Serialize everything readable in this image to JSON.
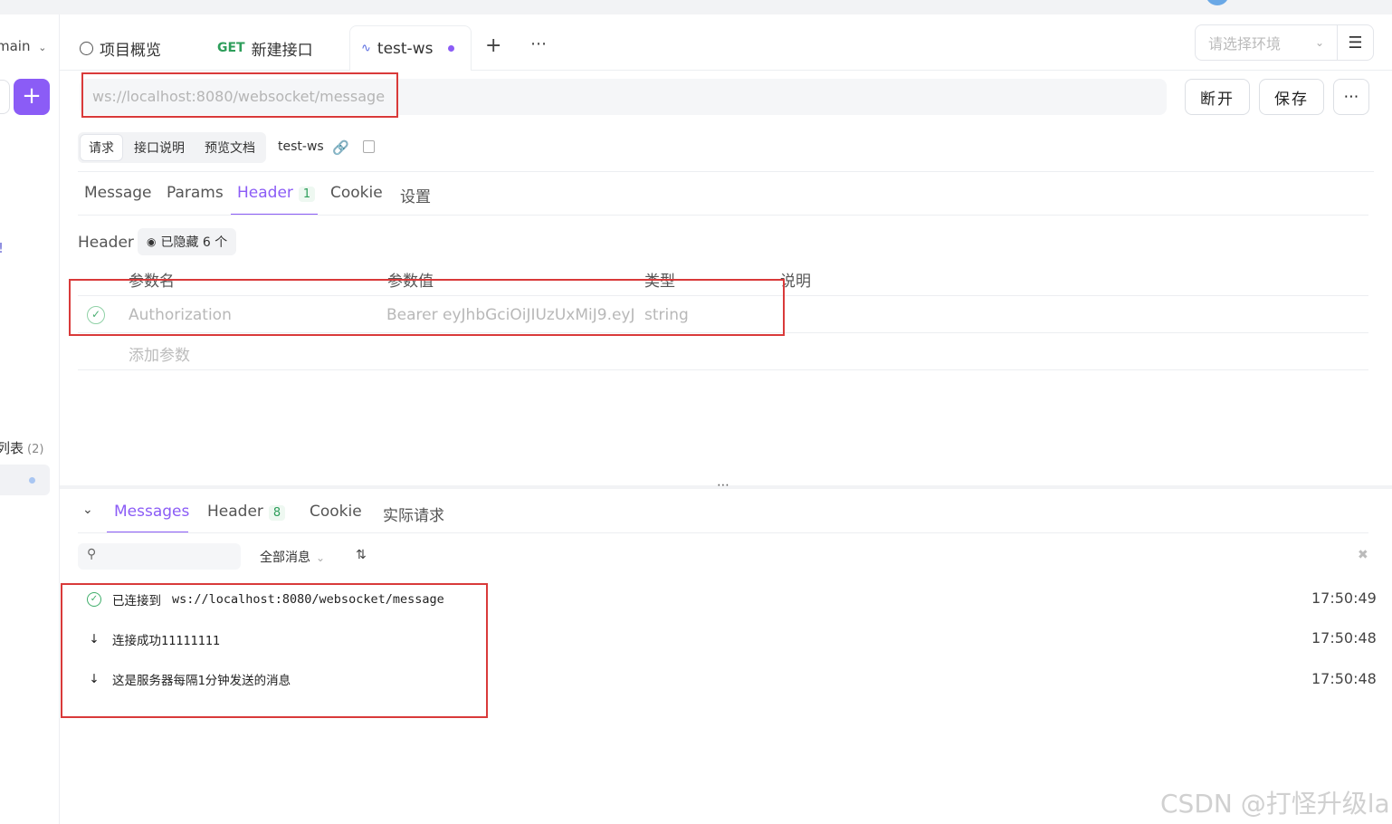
{
  "branch": "main",
  "sidebar": {
    "list_label": "列表",
    "list_count": "(2)"
  },
  "tabs": [
    {
      "label": "项目概览"
    },
    {
      "method": "GET",
      "label": "新建接口"
    },
    {
      "label": "test-ws"
    }
  ],
  "environment": {
    "placeholder": "请选择环境"
  },
  "url": {
    "value": "ws://localhost:8080/websocket/message"
  },
  "actions": {
    "disconnect": "断开",
    "save": "保存"
  },
  "segment": {
    "items": [
      "请求",
      "接口说明",
      "预览文档"
    ],
    "name": "test-ws"
  },
  "request_tabs": [
    {
      "label": "Message"
    },
    {
      "label": "Params"
    },
    {
      "label": "Header",
      "badge": "1"
    },
    {
      "label": "Cookie"
    },
    {
      "label": "设置"
    }
  ],
  "header_section": {
    "label": "Header",
    "hidden_chip": "已隐藏 6 个",
    "columns": [
      "参数名",
      "参数值",
      "类型",
      "说明"
    ],
    "row": {
      "name": "Authorization",
      "value": "Bearer eyJhbGciOiJIUzUxMiJ9.eyJ",
      "type": "string"
    },
    "add_param": "添加参数"
  },
  "response_tabs": [
    {
      "label": "Messages"
    },
    {
      "label": "Header",
      "badge": "8"
    },
    {
      "label": "Cookie"
    },
    {
      "label": "实际请求"
    }
  ],
  "filter": {
    "label": "全部消息"
  },
  "messages": [
    {
      "prefix": "已连接到",
      "text": "ws://localhost:8080/websocket/message",
      "time": "17:50:49",
      "kind": "connected"
    },
    {
      "prefix": "",
      "text": "连接成功11111111",
      "time": "17:50:48",
      "kind": "received"
    },
    {
      "prefix": "",
      "text": "这是服务器每隔1分钟发送的消息",
      "time": "17:50:48",
      "kind": "received"
    }
  ],
  "watermark": "CSDN @打怪升级la",
  "colors": {
    "accent": "#8b5cf6",
    "highlight_box": "#d93a3a",
    "get_method": "#2e9e5b"
  }
}
